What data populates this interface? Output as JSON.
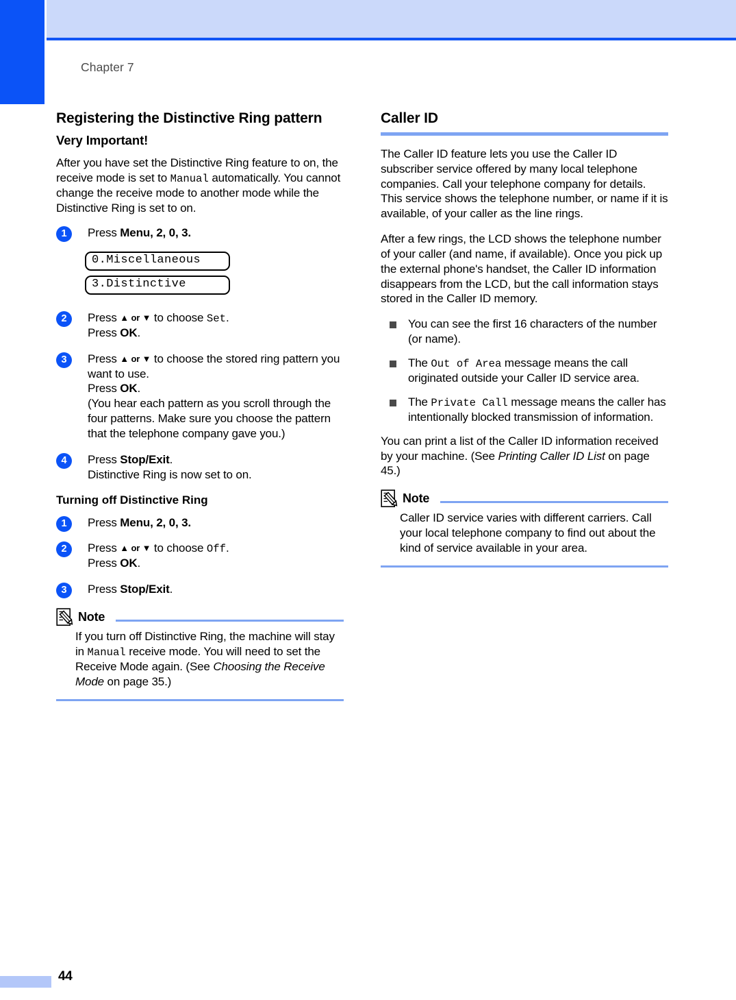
{
  "header": {
    "chapter_label": "Chapter 7"
  },
  "footer": {
    "page_number": "44"
  },
  "left_column": {
    "heading": "Registering the Distinctive Ring pattern",
    "subheading": "Very Important!",
    "intro_p1": "After you have set the Distinctive Ring feature to on, the receive mode is set to ",
    "intro_p1_lcd": "Manual",
    "intro_p1_cont": " automatically. You cannot change the receive mode to another mode while the Distinctive Ring is set to on.",
    "steps": [
      {
        "num": "1",
        "text_pre": "Press ",
        "key": "Menu",
        "keys": ", 2, 0, 3.",
        "lcd_lines": [
          "0.Miscellaneous",
          "3.Distinctive"
        ]
      },
      {
        "num": "2",
        "line1_pre": "Press ",
        "line1_arrows": "▲ or ▼",
        "line1_mid": " to choose ",
        "line1_lcd": "Set",
        "line1_post": ".",
        "line2_pre": "Press ",
        "line2_key": "OK",
        "line2_post": "."
      },
      {
        "num": "3",
        "line1_pre": "Press ",
        "line1_arrows": "▲ or ▼",
        "line1_mid": " to choose the stored ring pattern you want to use.",
        "line2_pre": "Press ",
        "line2_key": "OK",
        "line2_post": ".",
        "line3": "(You hear each pattern as you scroll through the four patterns. Make sure you choose the pattern that the telephone company gave you.)"
      },
      {
        "num": "4",
        "line1_pre": "Press ",
        "line1_key": "Stop/Exit",
        "line1_post": ".",
        "line2": "Distinctive Ring is now set to on."
      }
    ],
    "section2_heading": "Turning off Distinctive Ring",
    "section2_steps": [
      {
        "num": "1",
        "text_pre": "Press ",
        "key": "Menu",
        "keys": ", 2, 0, 3."
      },
      {
        "num": "2",
        "line1_pre": "Press ",
        "line1_arrows": "▲ or ▼",
        "line1_mid": " to choose ",
        "line1_lcd": "Off",
        "line1_post": ".",
        "line2_pre": "Press ",
        "line2_key": "OK",
        "line2_post": "."
      },
      {
        "num": "3",
        "line1_pre": "Press ",
        "line1_key": "Stop/Exit",
        "line1_post": "."
      }
    ],
    "note": {
      "title": "Note",
      "text_pre": "If you turn off Distinctive Ring, the machine will stay in ",
      "text_lcd": "Manual",
      "text_mid": " receive mode. You will need to set the Receive Mode again. (See ",
      "text_italic": "Choosing the Receive Mode",
      "text_post": " on page 35.)"
    }
  },
  "right_column": {
    "heading": "Caller ID",
    "p1": "The Caller ID feature lets you use the Caller ID subscriber service offered by many local telephone companies. Call your telephone company for details. This service shows the telephone number, or name if it is available, of your caller as the line rings.",
    "p2": "After a few rings, the LCD shows the telephone number of your caller (and name, if available). Once you pick up the external phone's handset, the Caller ID information disappears from the LCD, but the call information stays stored in the Caller ID memory.",
    "bullets": [
      {
        "pre": "You can see the first 16 characters of the number (or name).",
        "lcd": "",
        "post": ""
      },
      {
        "pre": "The ",
        "lcd": "Out of Area",
        "post": " message means the call originated outside your Caller ID service area."
      },
      {
        "pre": "The ",
        "lcd": "Private Call",
        "post": " message means the caller has intentionally blocked transmission of information."
      }
    ],
    "p3_pre": "You can print a list of the Caller ID information received by your machine. (See ",
    "p3_italic": "Printing Caller ID List",
    "p3_post": " on page 45.)",
    "note": {
      "title": "Note",
      "text": "Caller ID service varies with different carriers. Call your local telephone company to find out about the kind of service available in your area."
    }
  },
  "colors": {
    "tab_blue": "#0b53f7",
    "band_blue": "#cbd9fa",
    "rule_blue": "#1155f5",
    "underline_blue": "#7ea4f2",
    "footer_swatch": "#b3c7f9",
    "bullet_gray": "#4a4a4a"
  }
}
